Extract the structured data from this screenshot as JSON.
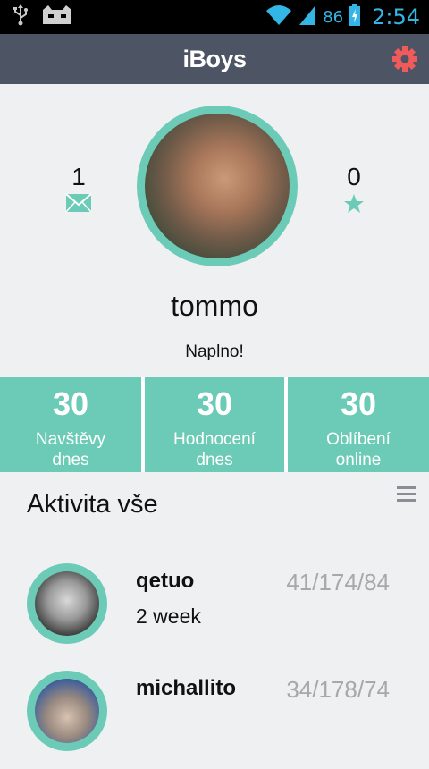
{
  "statusbar": {
    "battery_percent": "86",
    "time": "2:54",
    "icons": [
      "usb-icon",
      "cat-icon",
      "wifi-icon",
      "signal-icon",
      "battery-icon"
    ]
  },
  "appbar": {
    "title": "iBoys",
    "settings_icon": "gear-icon",
    "accent": "#f05a5a"
  },
  "profile": {
    "messages_count": "1",
    "favorites_count": "0",
    "username": "tommo",
    "tagline": "Naplno!"
  },
  "stats": [
    {
      "value": "30",
      "label_line1": "Navštěvy",
      "label_line2": "dnes"
    },
    {
      "value": "30",
      "label_line1": "Hodnocení",
      "label_line2": "dnes"
    },
    {
      "value": "30",
      "label_line1": "Oblíbení",
      "label_line2": "online"
    }
  ],
  "activity": {
    "title": "Aktivita vše",
    "items": [
      {
        "name": "qetuo",
        "score": "41/174/84",
        "time": "2 week"
      },
      {
        "name": "michallito",
        "score": "34/178/74",
        "time": ""
      }
    ]
  },
  "colors": {
    "accent": "#6ccbb6",
    "appbar": "#4d5464",
    "background": "#eff0f2"
  }
}
